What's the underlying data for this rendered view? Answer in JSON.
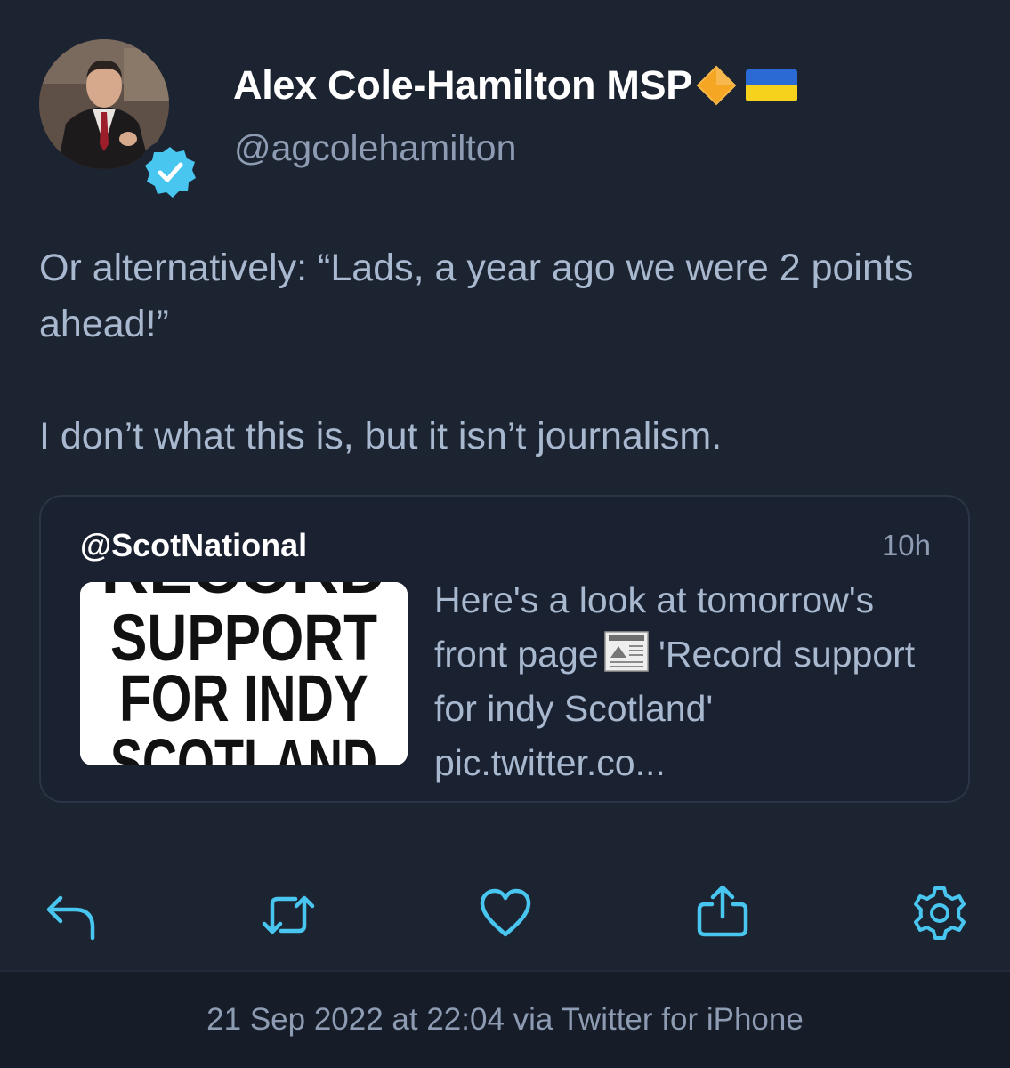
{
  "author": {
    "display_name": "Alex Cole-Hamilton MSP",
    "handle": "@agcolehamilton",
    "verified": true,
    "name_emoji": [
      "orange-diamond-icon",
      "ukraine-flag-icon"
    ]
  },
  "tweet": {
    "lines": [
      "Or alternatively: “Lads, a year ago we were 2 points ahead!”",
      "I don’t what this is, but it isn’t journalism."
    ]
  },
  "quoted_tweet": {
    "handle": "@ScotNational",
    "time": "10h",
    "text_before_emoji": "Here's a look at tomorrow's front page",
    "text_after_emoji": "'Record support for indy Scotland' pic.twitter.co...",
    "thumbnail_lines": [
      "RECORD",
      "SUPPORT",
      "FOR INDY",
      "SCOTLAND"
    ]
  },
  "actions": [
    "reply-icon",
    "retweet-icon",
    "like-icon",
    "share-icon",
    "settings-icon"
  ],
  "footer": {
    "timestamp": "21 Sep 2022 at 22:04 via Twitter for iPhone"
  },
  "colors": {
    "background": "#1c2331",
    "accent": "#49c6f0",
    "name": "#ffffff",
    "secondary": "#8d9cb3",
    "body_text": "#a8b8cf"
  }
}
